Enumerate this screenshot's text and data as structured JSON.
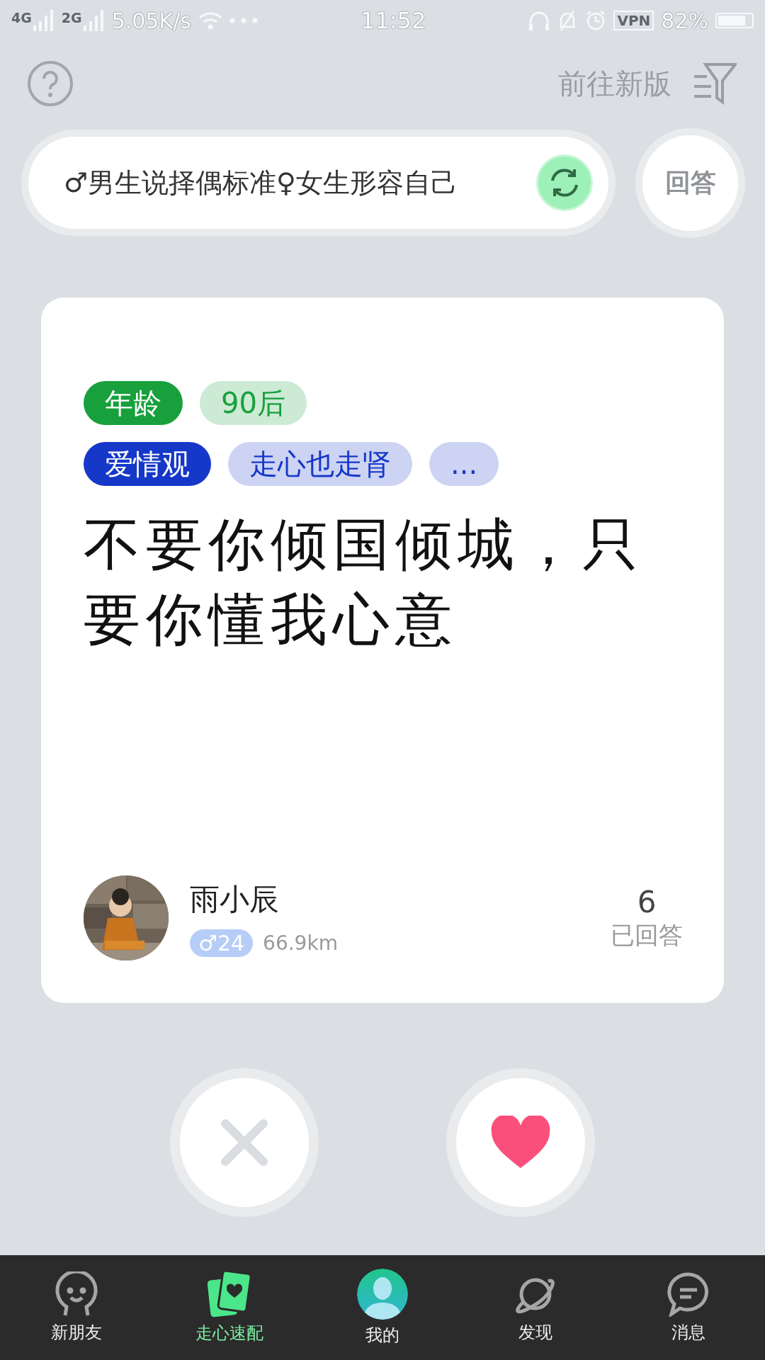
{
  "status_bar": {
    "network_1": "4G",
    "network_2": "2G",
    "speed": "5.05K/s",
    "time": "11:52",
    "vpn": "VPN",
    "battery": "82%"
  },
  "header": {
    "new_version_link": "前往新版"
  },
  "topic_bar": {
    "topic": "♂男生说择偶标准♀女生形容自己",
    "answer_button": "回答"
  },
  "card": {
    "tag_rows": [
      [
        {
          "label": "年龄",
          "kind": "category",
          "color": "#17a03c"
        },
        {
          "label": "90后",
          "kind": "value",
          "color": "#17a03c"
        }
      ],
      [
        {
          "label": "爱情观",
          "kind": "category",
          "color": "#1638c8"
        },
        {
          "label": "走心也走肾",
          "kind": "value",
          "color": "#1638c8"
        },
        {
          "label": "...",
          "kind": "value",
          "color": "#1638c8"
        }
      ]
    ],
    "text": "不要你倾国倾城，只要你懂我心意",
    "user": {
      "name": "雨小辰",
      "gender_age": "♂24",
      "distance": "66.9km"
    },
    "answer_count": "6",
    "answer_label": "已回答"
  },
  "actions": [
    {
      "kind": "dislike"
    },
    {
      "kind": "like"
    }
  ],
  "tabs": [
    {
      "label": "新朋友",
      "selected": false
    },
    {
      "label": "走心速配",
      "selected": true
    },
    {
      "label": "我的",
      "selected": false
    },
    {
      "label": "发现",
      "selected": false
    },
    {
      "label": "消息",
      "selected": false
    }
  ]
}
